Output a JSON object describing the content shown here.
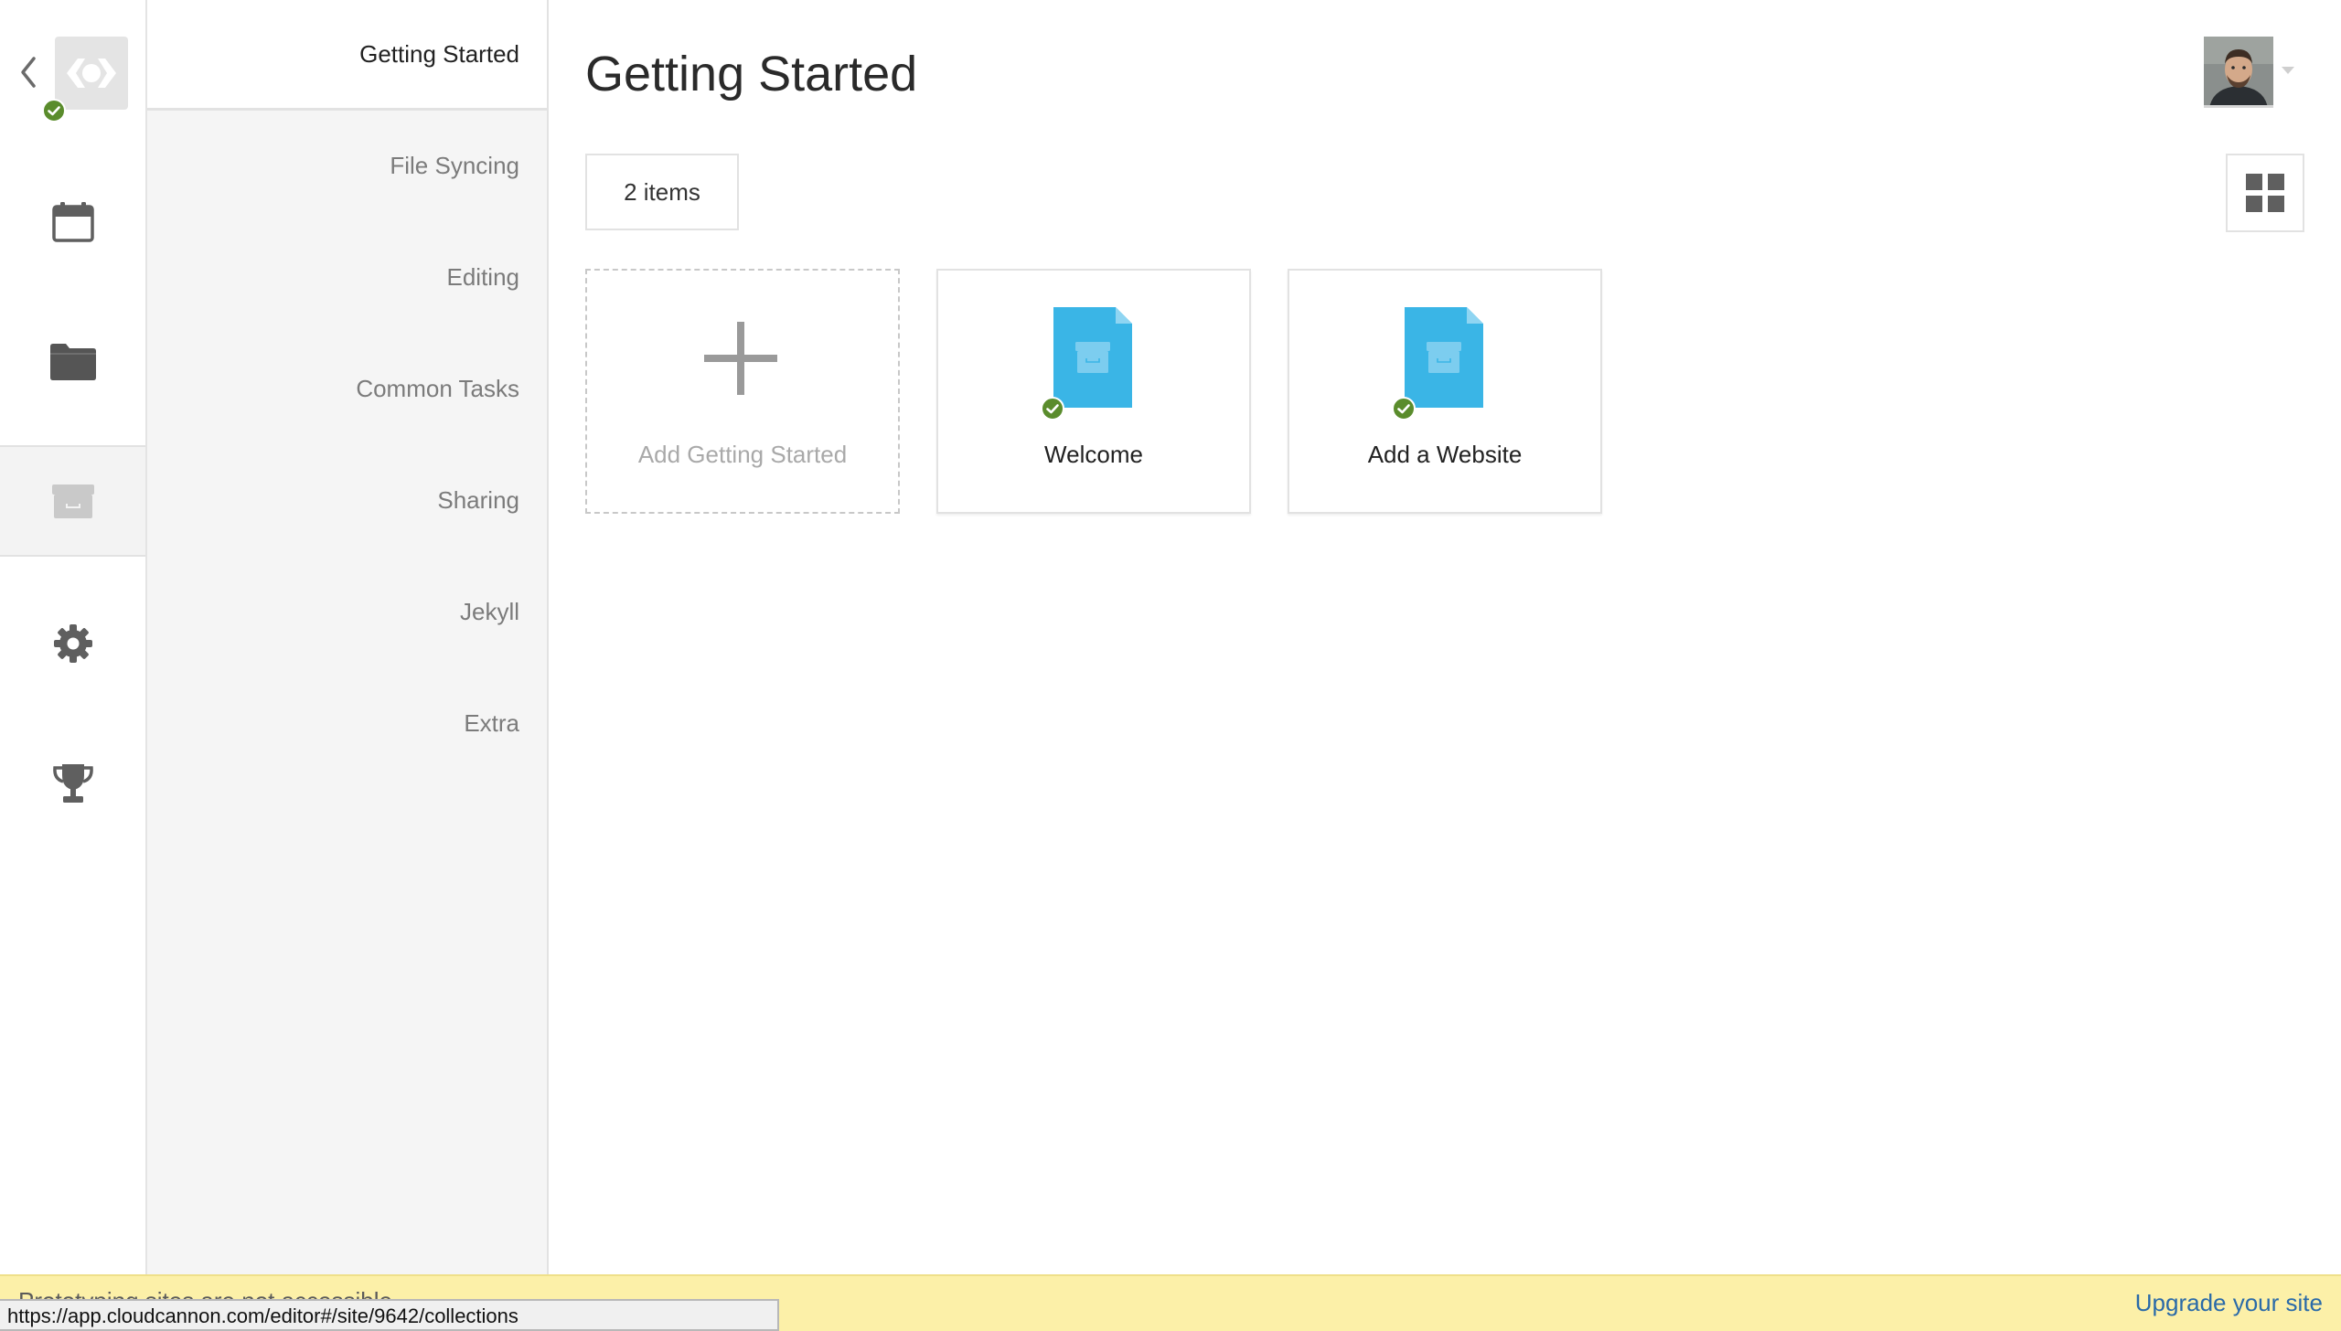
{
  "app": {
    "page_title": "Getting Started",
    "accent_color": "#3ab5e6",
    "success_color": "#5a8c2c"
  },
  "rail": {
    "back_icon": "chevron-left-icon",
    "logo_icon": "cloudcannon-logo-icon",
    "items": [
      {
        "icon": "calendar-icon",
        "active": false
      },
      {
        "icon": "folder-icon",
        "active": false
      },
      {
        "icon": "archive-box-icon",
        "active": true
      },
      {
        "icon": "gear-icon",
        "active": false
      },
      {
        "icon": "trophy-icon",
        "active": false
      }
    ]
  },
  "nav": {
    "items": [
      {
        "label": "Getting Started",
        "active": true
      },
      {
        "label": "File Syncing",
        "active": false
      },
      {
        "label": "Editing",
        "active": false
      },
      {
        "label": "Common Tasks",
        "active": false
      },
      {
        "label": "Sharing",
        "active": false
      },
      {
        "label": "Jekyll",
        "active": false
      },
      {
        "label": "Extra",
        "active": false
      }
    ]
  },
  "header": {
    "avatar_icon": "user-avatar",
    "caret_icon": "caret-down-icon"
  },
  "toolbar": {
    "count_label": "2 items",
    "view_icon": "grid-view-icon"
  },
  "cards": {
    "add_label": "Add Getting Started",
    "items": [
      {
        "label": "Welcome",
        "icon": "document-icon",
        "synced": true
      },
      {
        "label": "Add a Website",
        "icon": "document-icon",
        "synced": true
      }
    ]
  },
  "footer": {
    "notice": "Prototyping sites are not accessible",
    "upgrade_label": "Upgrade your site",
    "status_url": "https://app.cloudcannon.com/editor#/site/9642/collections"
  }
}
